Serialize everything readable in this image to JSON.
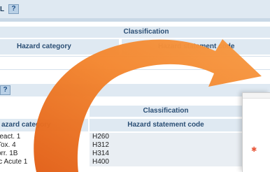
{
  "top_section": {
    "label": "L",
    "help_label": "?",
    "classification_label": "Classification",
    "hazard_category_header": "Hazard category",
    "hazard_statement_header": "Hazard statement code"
  },
  "lower_section": {
    "help_label": "?",
    "classification_label": "Classification",
    "hazard_category_header": "azard category",
    "hazard_statement_header": "Hazard statement code",
    "rows": [
      {
        "category": "react. 1",
        "code": "H260"
      },
      {
        "category": "Tox. 4",
        "code": "H312"
      },
      {
        "category": "orr. 1B",
        "code": "H314"
      },
      {
        "category": "ic Acute 1",
        "code": "H400"
      }
    ]
  },
  "popup": {
    "icon": "hazard-star-icon"
  },
  "colors": {
    "header_bg": "#dfe9f2",
    "header_text": "#2a4e74",
    "code_cell_bg": "#e9eef3",
    "arrow": "#f07d2a"
  }
}
